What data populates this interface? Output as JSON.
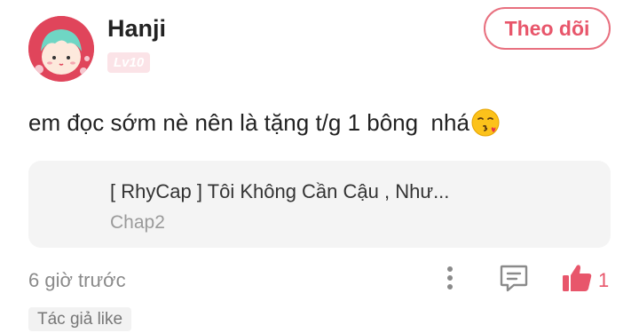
{
  "user": {
    "name": "Hanji",
    "level": "Lv10"
  },
  "follow_button": {
    "label": "Theo dõi"
  },
  "comment": {
    "text": "em đọc sớm nè nên là tặng t/g 1 bông  nhá",
    "emoji": "face-blowing-a-kiss"
  },
  "story": {
    "title": "[ RhyCap ] Tôi Không Cần Cậu , Như...",
    "chapter": "Chap2"
  },
  "meta": {
    "time": "6 giờ trước",
    "likes": "1",
    "author_like": "Tác giả like"
  },
  "colors": {
    "accent": "#e8566b",
    "badge_bg": "#fbe3e7",
    "card_bg": "#f4f4f4"
  },
  "icons": [
    "more-vertical-icon",
    "reply-icon",
    "thumbs-up-icon"
  ]
}
